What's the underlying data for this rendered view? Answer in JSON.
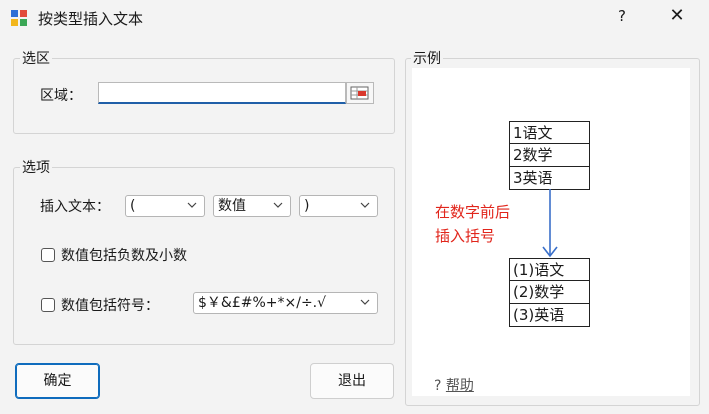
{
  "window": {
    "title": "按类型插入文本",
    "help_glyph": "?",
    "close_glyph": "✕"
  },
  "selection_group": {
    "title": "选区",
    "area_label": "区域：",
    "area_value": ""
  },
  "options_group": {
    "title": "选项",
    "insert_text_label": "插入文本：",
    "combo_left": "(",
    "combo_type": "数值",
    "combo_right": ")",
    "checkbox_negative_decimal": "数值包括负数及小数",
    "checkbox_negative_checked": false,
    "checkbox_symbols": "数值包括符号：",
    "checkbox_symbols_checked": false,
    "symbols_value": "$￥&£#%+*×/÷.√"
  },
  "buttons": {
    "ok": "确定",
    "exit": "退出"
  },
  "example": {
    "title": "示例",
    "before": [
      "1语文",
      "2数学",
      "3英语"
    ],
    "note_line1": "在数字前后",
    "note_line2": "插入括号",
    "after": [
      "(1)语文",
      "(2)数学",
      "(3)英语"
    ],
    "help_link": "帮助",
    "help_icon": "?"
  },
  "colors": {
    "accent": "#0f6cbd",
    "note": "#e1251b",
    "arrow": "#3a6fc9"
  }
}
